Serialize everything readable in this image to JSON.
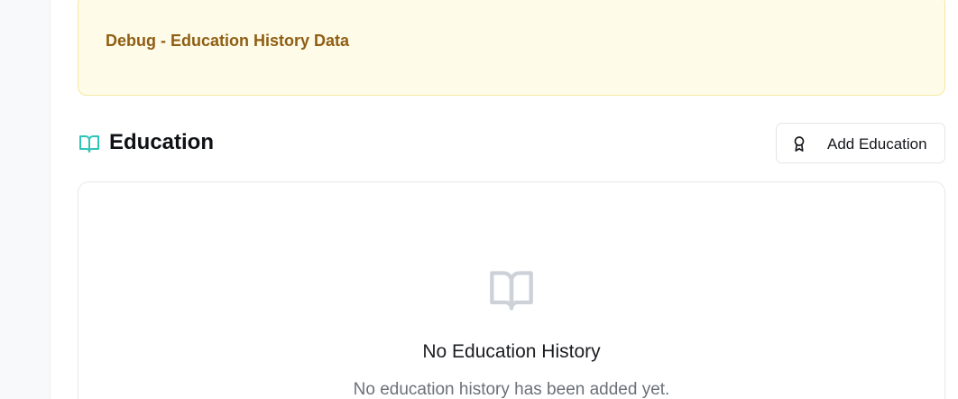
{
  "debug": {
    "title": "Debug - Education History Data"
  },
  "section": {
    "icon": "open-book-icon",
    "title": "Education",
    "add_button": {
      "icon": "award-ribbon-icon",
      "label": "Add Education"
    }
  },
  "empty_state": {
    "icon": "open-book-icon",
    "title": "No Education History",
    "description": "No education history has been added yet."
  },
  "colors": {
    "debug_bg": "#fefbe8",
    "debug_border": "#f7e7a3",
    "debug_text": "#8f5e13",
    "accent_teal": "#2ec4b6",
    "empty_icon": "#cdd1d8"
  }
}
